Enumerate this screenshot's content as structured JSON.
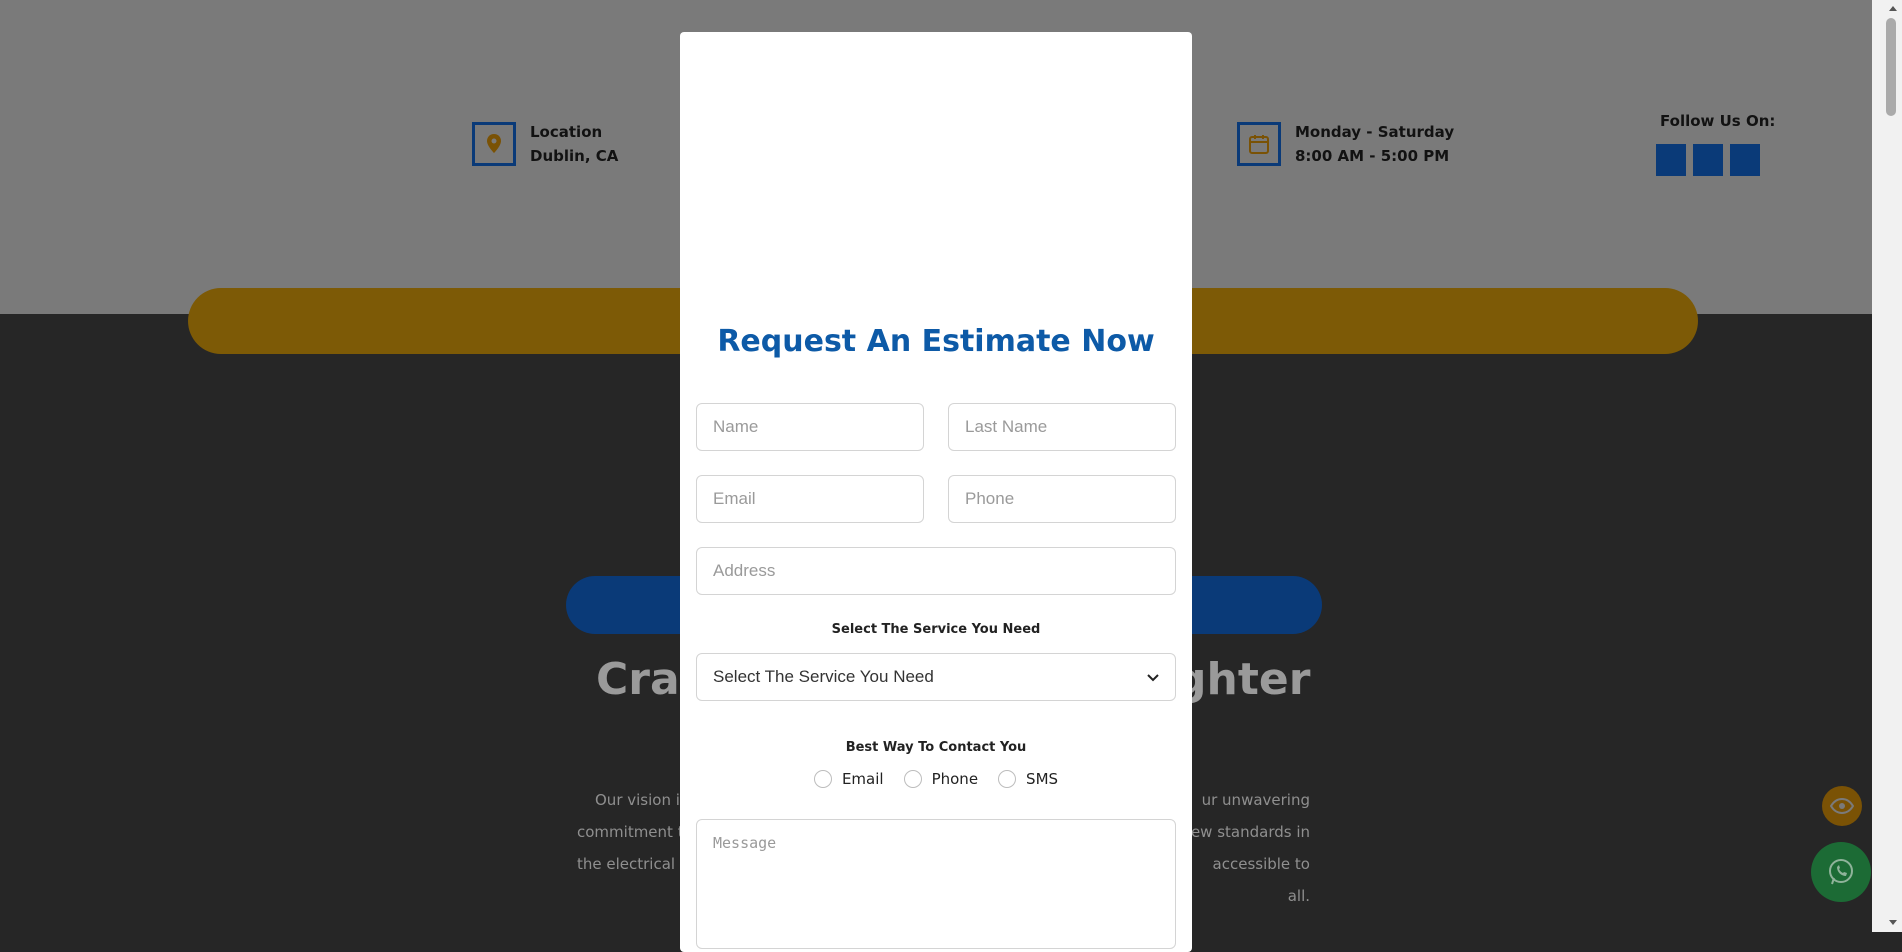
{
  "header": {
    "location_label": "Location",
    "location_value": "Dublin, CA",
    "hours_label": "Monday - Saturday",
    "hours_value": "8:00 AM - 5:00 PM",
    "follow_label": "Follow Us On:"
  },
  "background": {
    "heading_left": "Craf",
    "heading_right": "ghter",
    "para_left": [
      "Our vision is",
      "commitment t",
      "the electrical i"
    ],
    "para_right": [
      "ur unwavering",
      "new standards in",
      "accessible to all."
    ]
  },
  "modal": {
    "title": "Request An Estimate Now",
    "name_placeholder": "Name",
    "last_name_placeholder": "Last Name",
    "email_placeholder": "Email",
    "phone_placeholder": "Phone",
    "address_placeholder": "Address",
    "service_label": "Select The Service You Need",
    "service_selected": "Select The Service You Need",
    "contact_label": "Best Way To Contact You",
    "contact_options": [
      "Email",
      "Phone",
      "SMS"
    ],
    "message_placeholder": "Message"
  },
  "colors": {
    "brand_blue": "#0d5aa7",
    "accent_orange": "#f5b00f",
    "whatsapp_green": "#25a244"
  }
}
